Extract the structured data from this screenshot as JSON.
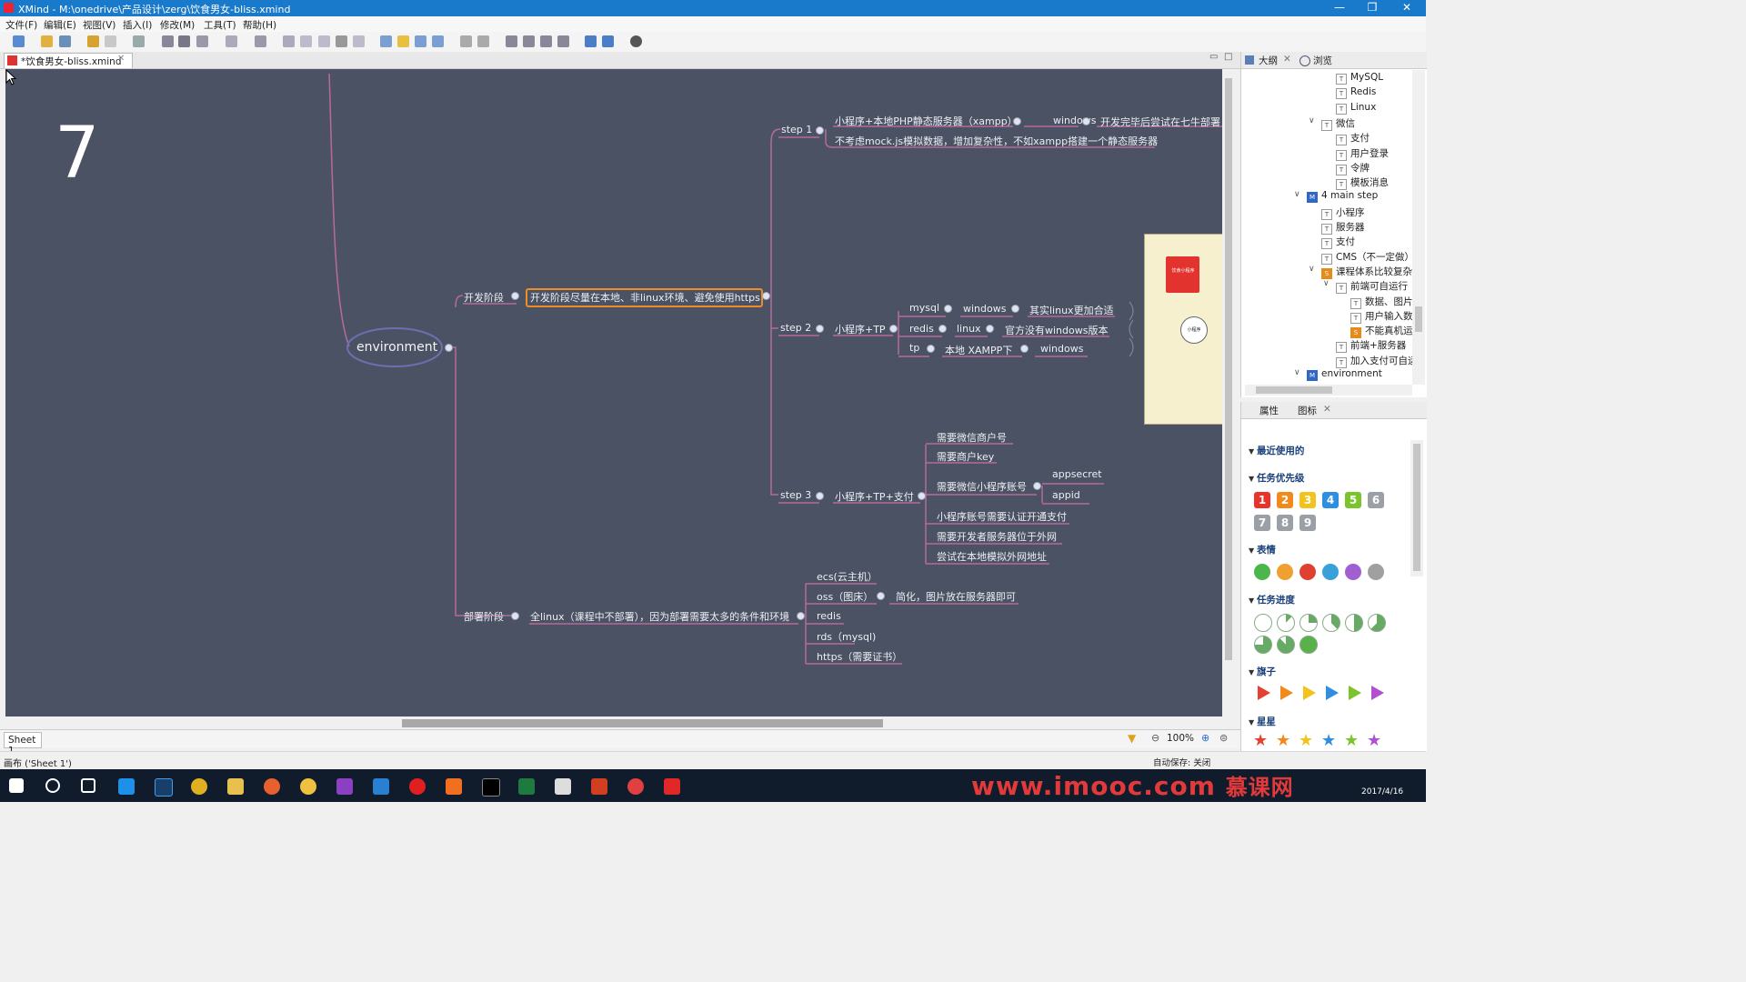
{
  "window": {
    "title": "XMind - M:\\onedrive\\产品设计\\zerg\\饮食男女-bliss.xmind"
  },
  "menu": [
    "文件(F)",
    "编辑(E)",
    "视图(V)",
    "插入(I)",
    "修改(M)",
    "工具(T)",
    "帮助(H)"
  ],
  "editor_tab": {
    "label": "*饮食男女-bliss.xmind"
  },
  "canvas": {
    "big_number": "7",
    "central": "environment",
    "dev_stage": "开发阶段",
    "dev_note": "开发阶段尽量在本地、非linux环境、避免使用https",
    "step1": "step 1",
    "step1_a": "小程序+本地PHP静态服务器（xampp）",
    "step1_a_os": "windows",
    "step1_a_note": "开发完毕后尝试在七牛部署",
    "step1_b": "不考虑mock.js模拟数据，增加复杂性，不如xampp搭建一个静态服务器",
    "step2": "step 2",
    "step2_a": "小程序+TP",
    "step2_mysql": "mysql",
    "step2_mysql_os": "windows",
    "step2_mysql_note": "其实linux更加合适",
    "step2_redis": "redis",
    "step2_redis_os": "linux",
    "step2_redis_note": "官方没有windows版本",
    "step2_tp": "tp",
    "step2_tp_local": "本地 XAMPP下",
    "step2_tp_os": "windows",
    "step3": "step 3",
    "step3_a": "小程序+TP+支付",
    "step3_items": [
      "需要微信商户号",
      "需要商户key",
      "需要微信小程序账号",
      "小程序账号需要认证开通支付",
      "需要开发者服务器位于外网",
      "尝试在本地模拟外网地址"
    ],
    "step3_sub": [
      "appsecret",
      "appid"
    ],
    "deploy_stage": "部署阶段",
    "deploy_note": "全linux（课程中不部署），因为部署需要太多的条件和环境",
    "deploy_items": [
      "ecs(云主机）",
      "oss（图床）",
      "redis",
      "rds（mysql)",
      "https（需要证书）"
    ],
    "deploy_oss_note": "简化，图片放在服务器即可",
    "thumb_book": "饮食小程序",
    "thumb_circle": "小程序"
  },
  "sheet_tab": "Sheet 1",
  "zoom": "100%",
  "status": {
    "left": "画布 ('Sheet 1')",
    "right": "自动保存: 关闭"
  },
  "outline": {
    "tabs": [
      "大纲",
      "浏览"
    ],
    "rows": [
      {
        "label": "MySQL",
        "icon": "T"
      },
      {
        "label": "Redis",
        "icon": "T"
      },
      {
        "label": "Linux",
        "icon": "T"
      },
      {
        "label": "微信",
        "icon": "T"
      },
      {
        "label": "支付",
        "icon": "T"
      },
      {
        "label": "用户登录",
        "icon": "T"
      },
      {
        "label": "令牌",
        "icon": "T"
      },
      {
        "label": "模板消息",
        "icon": "T"
      },
      {
        "label": "4 main step",
        "icon": "M"
      },
      {
        "label": "小程序",
        "icon": "T"
      },
      {
        "label": "服务器",
        "icon": "T"
      },
      {
        "label": "支付",
        "icon": "T"
      },
      {
        "label": "CMS（不一定做）",
        "icon": "T"
      },
      {
        "label": "课程体系比较复杂，",
        "icon": "S"
      },
      {
        "label": "前端可自运行",
        "icon": "T"
      },
      {
        "label": "数据、图片由",
        "icon": "T"
      },
      {
        "label": "用户输入数据",
        "icon": "T"
      },
      {
        "label": "不能真机运行",
        "icon": "S"
      },
      {
        "label": "前端+服务器（",
        "icon": "T"
      },
      {
        "label": "加入支付可自运",
        "icon": "T"
      },
      {
        "label": "environment",
        "icon": "M"
      }
    ]
  },
  "icons_panel": {
    "tabs": [
      "属性",
      "图标"
    ],
    "sections": [
      "最近使用的",
      "任务优先级",
      "表情",
      "任务进度",
      "旗子",
      "星星"
    ],
    "priorities": [
      "1",
      "2",
      "3",
      "4",
      "5",
      "6",
      "7",
      "8",
      "9"
    ],
    "priority_colors": [
      "#e8322a",
      "#f08a1c",
      "#f3c21c",
      "#2f8ee0",
      "#7cc42c",
      "#9aa0a6",
      "#9aa0a6",
      "#9aa0a6",
      "#9aa0a6"
    ]
  },
  "taskbar": {
    "watermark": "www.imooc.com",
    "watermark2": "慕课网",
    "clock": "2017/4/16"
  }
}
